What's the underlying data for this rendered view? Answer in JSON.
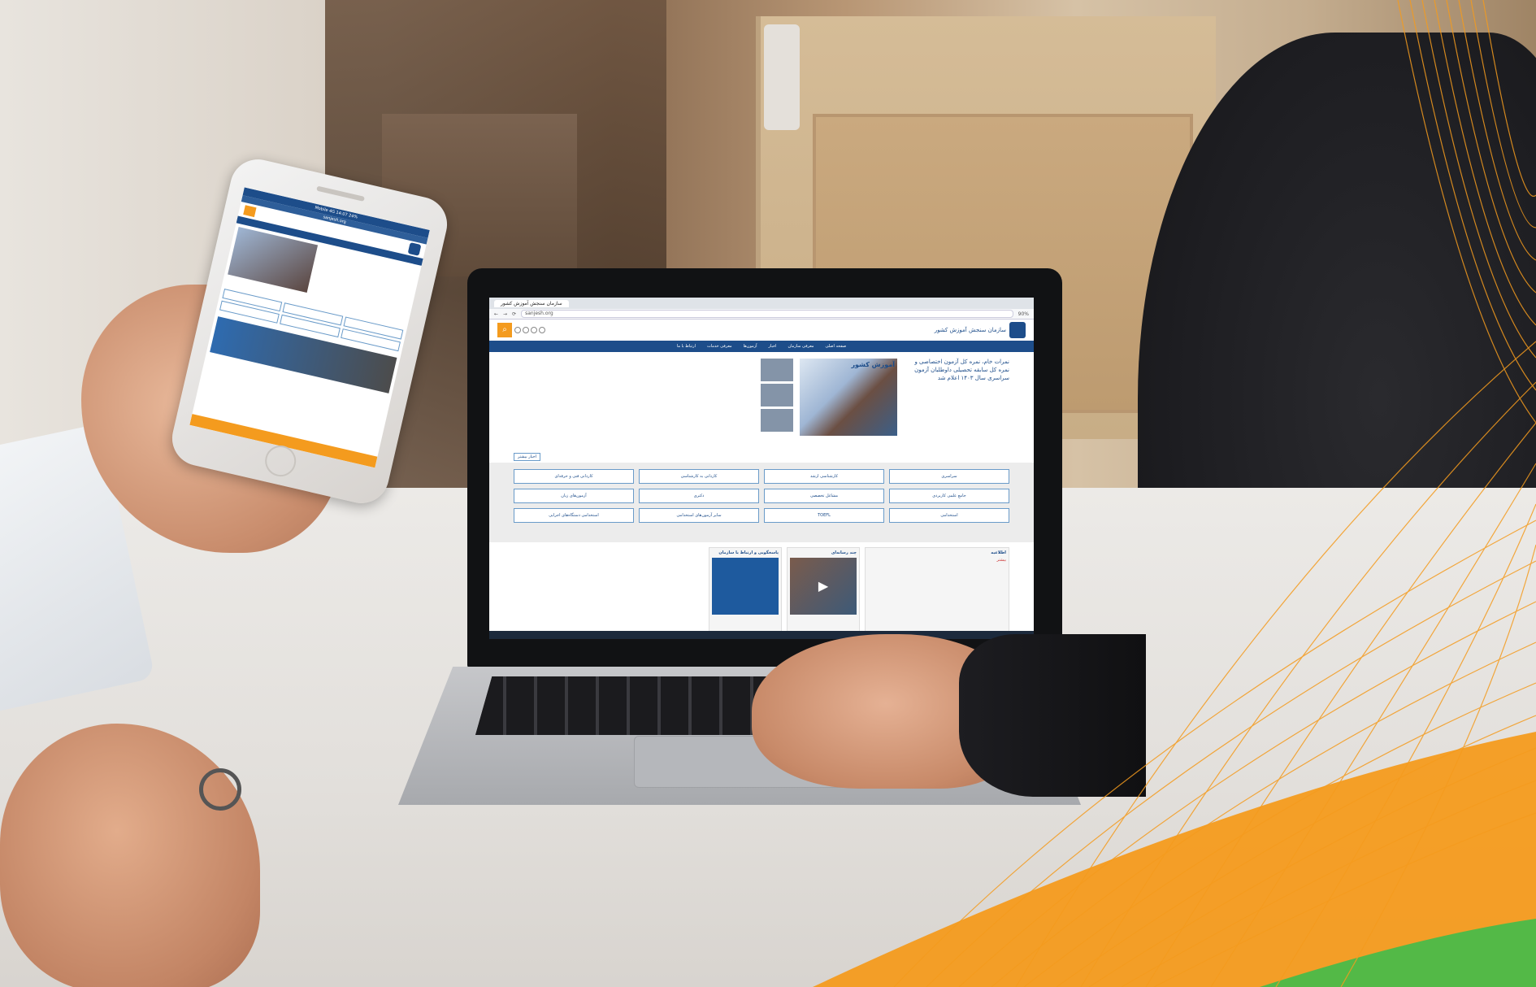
{
  "laptop_browser": {
    "tab_title": "سازمان سنجش آموزش کشور",
    "address": "sanjesh.org",
    "zoom": "90%"
  },
  "site": {
    "logo_text": "سازمان سنجش آموزش کشور",
    "nav": [
      "صفحه اصلی",
      "معرفی سازمان",
      "اخبار",
      "آزمون‌ها",
      "معرفی خدمات",
      "ارتباط با ما"
    ],
    "hero_banner_text": "آموزش کشور",
    "headline": "نمرات خام، نمره کل آزمون اختصاصی و نمره کل سابقه تحصیلی داوطلبان آزمون سراسری سال ۱۴۰۳ اعلام شد",
    "more_news_button": "اخبار بیشتر",
    "services": [
      "سراسری",
      "کارشناسی ارشد",
      "کاردانی به کارشناسی",
      "کاردانی فنی و حرفه‌ای",
      "جامع علمی کاربردی",
      "مشاغل تخصصی",
      "دکتری",
      "آزمون‌های زبان",
      "استخدامی",
      "TOEFL",
      "سایر آزمون‌های استخدامی",
      "استخدامی دستگاه‌های اجرایی"
    ],
    "panels": {
      "news_title": "اطلاعیه",
      "video_title": "چند رسانه‌ای",
      "info_title": "پاسخگویی و ارتباط با سازمان",
      "more_label": "بیشتر"
    }
  },
  "phone": {
    "status_left": "Mobile 4G",
    "status_time": "14:07",
    "status_right": "24%",
    "url": "sanjesh.org"
  },
  "colors": {
    "brand_blue": "#1d4d8a",
    "accent_orange": "#f49b1e",
    "wave_orange": "#f49b1e",
    "wave_green": "#53b947"
  }
}
